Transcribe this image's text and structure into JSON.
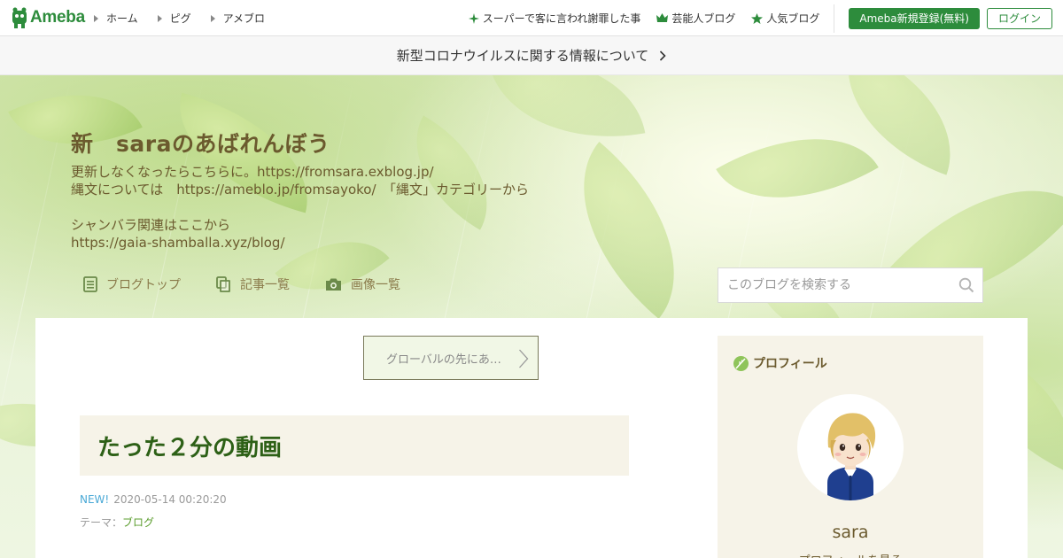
{
  "header": {
    "logo_text": "Ameba",
    "nav": [
      {
        "label": "ホーム"
      },
      {
        "label": "ピグ"
      },
      {
        "label": "アメブロ"
      }
    ],
    "links": [
      {
        "label": "スーパーで客に言われ謝罪した事",
        "icon": "sparkle-icon"
      },
      {
        "label": "芸能人ブログ",
        "icon": "crown-icon"
      },
      {
        "label": "人気ブログ",
        "icon": "star-icon"
      }
    ],
    "register_label": "Ameba新規登録(無料)",
    "login_label": "ログイン",
    "brand_color": "#2d8c3c"
  },
  "notice": {
    "text": "新型コロナウイルスに関する情報について"
  },
  "blog": {
    "title": "新　saraのあばれんぼう",
    "description": [
      "更新しなくなったらこちらに。https://fromsara.exblog.jp/",
      "縄文については　https://ameblo.jp/fromsayoko/　「縄文」カテゴリーから",
      "",
      "シャンバラ関連はここから",
      "https://gaia-shamballa.xyz/blog/"
    ],
    "nav": [
      {
        "label": "ブログトップ",
        "icon": "document-icon"
      },
      {
        "label": "記事一覧",
        "icon": "copy-icon"
      },
      {
        "label": "画像一覧",
        "icon": "camera-icon"
      }
    ],
    "search_placeholder": "このブログを検索する"
  },
  "pager": {
    "label": "グローバルの先にあ…"
  },
  "entry": {
    "title": "たった２分の動画",
    "new_badge": "NEW!",
    "date": "2020-05-14 00:20:20",
    "theme_label": "テーマ：",
    "theme": "ブログ"
  },
  "profile": {
    "heading": "プロフィール",
    "name": "sara",
    "more": "プロフィールを見る"
  }
}
